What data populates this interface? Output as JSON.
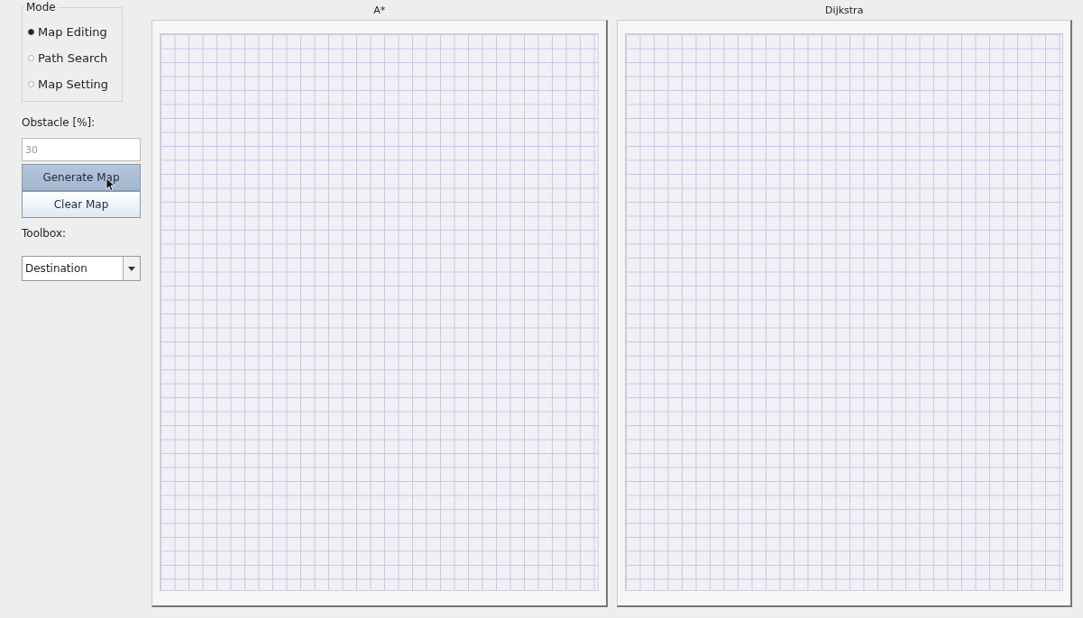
{
  "mode": {
    "title": "Mode",
    "options": [
      {
        "label": "Map Editing",
        "selected": true
      },
      {
        "label": "Path Search",
        "selected": false
      },
      {
        "label": "Map Setting",
        "selected": false
      }
    ]
  },
  "obstacle": {
    "label": "Obstacle [%]:",
    "value": "30"
  },
  "buttons": [
    {
      "label": "Generate Map",
      "highlighted": true
    },
    {
      "label": "Clear Map",
      "highlighted": false
    }
  ],
  "toolbox": {
    "label": "Toolbox:",
    "value": "Destination"
  },
  "panels": [
    {
      "title": "A*"
    },
    {
      "title": "Dijkstra"
    }
  ]
}
